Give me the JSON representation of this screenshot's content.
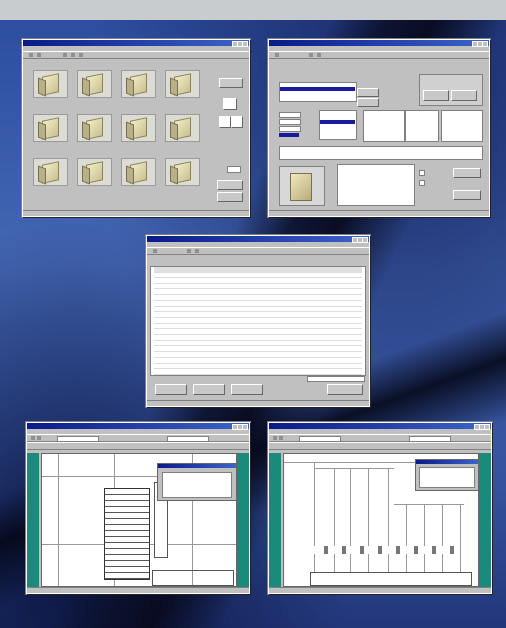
{
  "windows": {
    "w1": {
      "thumbnails": [
        "",
        "",
        "",
        "",
        "",
        "",
        "",
        "",
        "",
        "",
        "",
        ""
      ],
      "buttons": [
        "",
        "",
        "",
        ""
      ]
    },
    "w2": {
      "buttons": [
        "",
        "",
        "",
        "",
        "",
        ""
      ]
    },
    "w3": {
      "columns": [
        "",
        "",
        "",
        ""
      ],
      "rows": [
        [
          "",
          "",
          "",
          ""
        ],
        [
          "",
          "",
          "",
          ""
        ],
        [
          "",
          "",
          "",
          ""
        ],
        [
          "",
          "",
          "",
          ""
        ],
        [
          "",
          "",
          "",
          ""
        ],
        [
          "",
          "",
          "",
          ""
        ],
        [
          "",
          "",
          "",
          ""
        ],
        [
          "",
          "",
          "",
          ""
        ],
        [
          "",
          "",
          "",
          ""
        ],
        [
          "",
          "",
          "",
          ""
        ],
        [
          "",
          "",
          "",
          ""
        ],
        [
          "",
          "",
          "",
          ""
        ],
        [
          "",
          "",
          "",
          ""
        ],
        [
          "",
          "",
          "",
          ""
        ],
        [
          "",
          "",
          "",
          ""
        ],
        [
          "",
          "",
          "",
          ""
        ],
        [
          "",
          "",
          "",
          ""
        ],
        [
          "",
          "",
          "",
          ""
        ]
      ],
      "buttons": [
        "",
        "",
        "",
        ""
      ]
    },
    "w4": {},
    "w5": {}
  },
  "colors": {
    "background_blue": "#3f5fa8",
    "title_bar": "#0a1a8a",
    "window_gray": "#c0c0c0",
    "teal_panel": "#1a8a7a",
    "selection": "#1a1aa0"
  },
  "icons": [
    "window-close-icon",
    "window-maximize-icon",
    "window-minimize-icon",
    "arrow-left-icon",
    "arrow-right-icon",
    "arrow-up-icon"
  ]
}
